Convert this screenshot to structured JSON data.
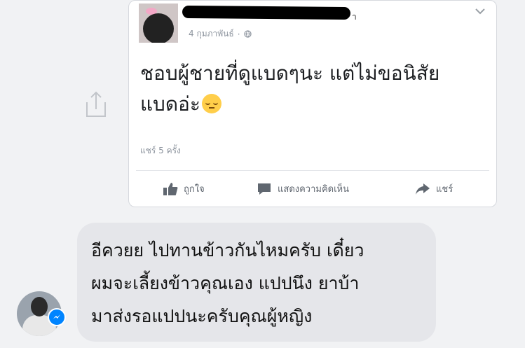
{
  "post": {
    "name_suffix": "า",
    "date": "4 กุมภาพันธ์",
    "separator": "·",
    "text_lines": [
      "ชอบผู้ชายที่ดูแบดๆนะ แต่ไม่ขอนิสัย",
      "แบดอ่ะ"
    ],
    "emoji": "pensive-face-icon",
    "share_count": "แชร์ 5 ครั้ง",
    "actions": {
      "like": "ถูกใจ",
      "comment": "แสดงความคิดเห็น",
      "share": "แชร์"
    }
  },
  "reply": {
    "lines": [
      "อีควยย ไปทานข้าวกันไหมครับ เดี๋ยว",
      "ผมจะเลี้ยงข้าวคุณเอง แปปนึง ยาบ้า",
      "มาส่งรอแปปนะครับคุณผู้หญิง"
    ]
  },
  "colors": {
    "background": "#f1f2f4",
    "card": "#ffffff",
    "bubble": "#e5e6ea",
    "messenger_blue": "#0084ff",
    "meta_gray": "#8d949e"
  }
}
